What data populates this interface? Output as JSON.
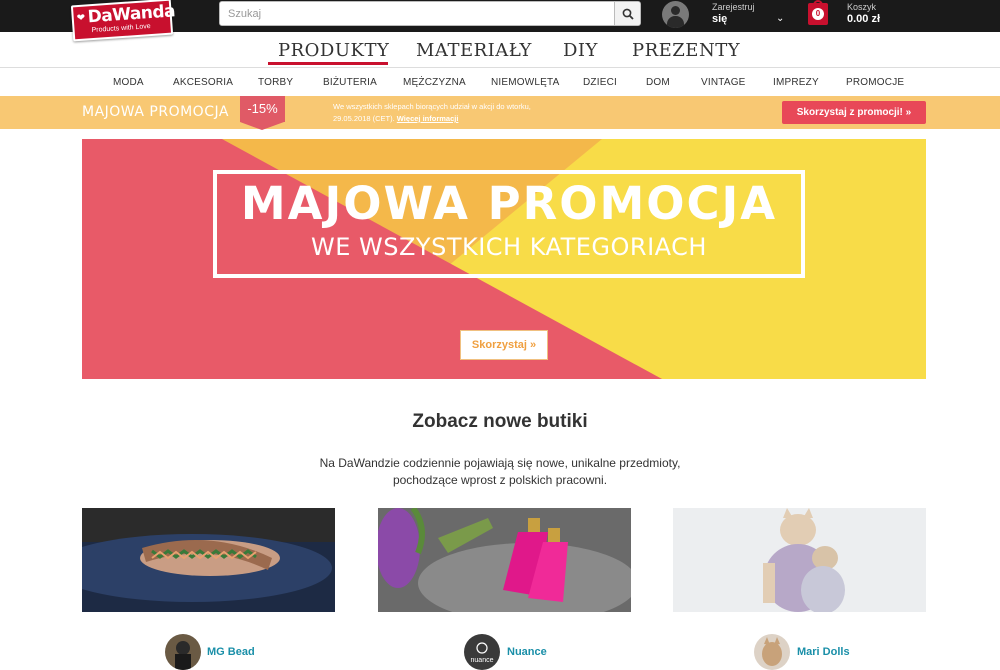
{
  "header": {
    "logo_name": "DaWanda",
    "logo_tagline": "Products with Love",
    "search_placeholder": "Szukaj",
    "account_top": "Zarejestruj",
    "account_bottom": "się",
    "cart_label": "Koszyk",
    "cart_total": "0.00 zł",
    "cart_count": "0",
    "brand_color": "#c8102e"
  },
  "main_nav": [
    "PRODUKTY",
    "MATERIAŁY",
    "DIY",
    "PREZENTY"
  ],
  "sub_nav": [
    "MODA",
    "AKCESORIA",
    "TORBY",
    "BIŻUTERIA",
    "MĘŻCZYZNA",
    "NIEMOWLĘTA",
    "DZIECI",
    "DOM",
    "VINTAGE",
    "IMPREZY",
    "PROMOCJE"
  ],
  "promo": {
    "title": "MAJOWA PROMOCJA",
    "badge": "-15%",
    "text": "We wszystkich sklepach biorących udział w akcji do wtorku, 29.05.2018 (CET).",
    "more_link": "Więcej informacji",
    "button": "Skorzystaj z promocji! »",
    "strip_color": "#f8c873",
    "accent_color": "#e84858"
  },
  "hero": {
    "title": "MAJOWA PROMOCJA",
    "subtitle": "WE WSZYSTKICH KATEGORIACH",
    "button": "Skorzystaj »",
    "colors": {
      "pink": "#e85a68",
      "orange": "#f4b84a",
      "yellow": "#f8dc48"
    }
  },
  "section": {
    "title": "Zobacz nowe butiki",
    "description": "Na DaWandzie codziennie pojawiają się nowe, unikalne przedmioty, pochodzące wprost z polskich pracowni."
  },
  "shops": [
    {
      "name": "MG Bead"
    },
    {
      "name": "Nuance",
      "avatar_text": "nuance"
    },
    {
      "name": "Mari Dolls"
    }
  ]
}
